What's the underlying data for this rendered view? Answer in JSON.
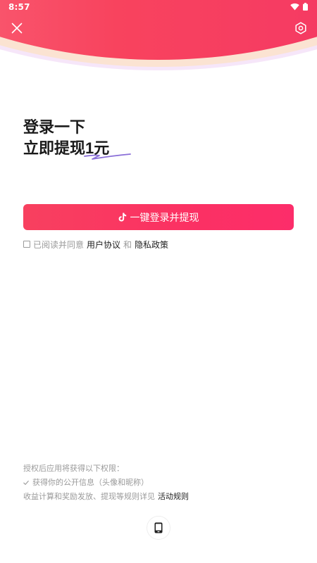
{
  "status_bar": {
    "time": "8:57"
  },
  "header": {
    "close_icon": "close-icon",
    "settings_icon": "hexagon-settings-icon"
  },
  "headline": {
    "line1": "登录一下",
    "line2": "立即提现1元"
  },
  "login_button": {
    "label": "一键登录并提现",
    "icon": "tiktok-icon"
  },
  "agreement": {
    "prefix": "已阅读并同意",
    "user_agreement": "用户协议",
    "conjunction": "和",
    "privacy_policy": "隐私政策"
  },
  "permissions": {
    "intro": "授权后应用将获得以下权限：",
    "item1": "获得你的公开信息（头像和昵称）",
    "rules_text": "收益计算和奖励发放、提现等规则详见",
    "rules_link": "活动规则"
  },
  "other_login": {
    "phone_icon": "phone-icon"
  },
  "colors": {
    "accent": "#f8405f",
    "accent_end": "#fc2d6a",
    "muted_text": "#9a9a9a",
    "dark_text": "#222222"
  }
}
